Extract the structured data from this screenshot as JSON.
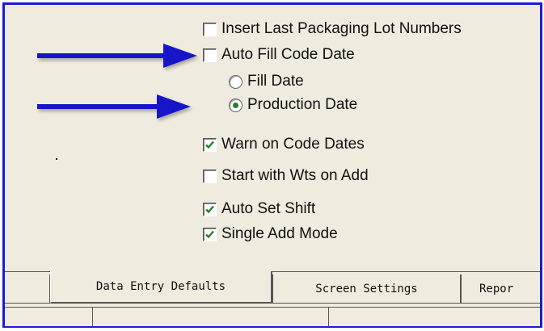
{
  "options": {
    "insert_last_lot": {
      "label": "Insert Last Packaging Lot Numbers",
      "checked": false
    },
    "auto_fill_code_date": {
      "label": "Auto Fill Code Date",
      "checked": false
    },
    "fill_date": {
      "label": "Fill Date",
      "selected": false
    },
    "production_date": {
      "label": "Production Date",
      "selected": true
    },
    "warn_code_dates": {
      "label": "Warn on Code Dates",
      "checked": true
    },
    "start_wts_add": {
      "label": "Start with Wts on Add",
      "checked": false
    },
    "auto_set_shift": {
      "label": "Auto Set Shift",
      "checked": true
    },
    "single_add_mode": {
      "label": "Single Add Mode",
      "checked": true
    }
  },
  "tabs": [
    {
      "label": "Data Entry Defaults",
      "active": true
    },
    {
      "label": "Screen Settings",
      "active": false
    },
    {
      "label": "Repor",
      "active": false
    }
  ],
  "colors": {
    "frame_border": "#1b1bd8",
    "panel_background": "#efebde",
    "arrow": "#1414c8",
    "check_mark": "#2a7d2a"
  }
}
